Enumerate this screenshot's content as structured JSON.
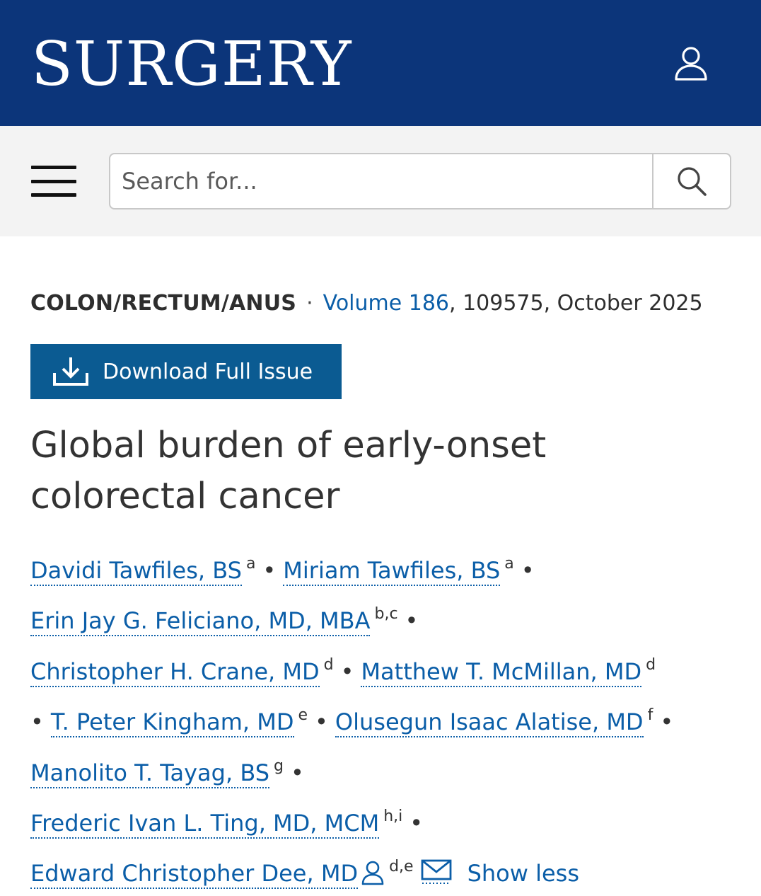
{
  "header": {
    "logo": "SURGERY"
  },
  "search": {
    "placeholder": "Search for..."
  },
  "article": {
    "section": "COLON/RECTUM/ANUS",
    "separator": "·",
    "volume_link": "Volume 186",
    "citation_rest": ", 109575, October 2025",
    "download_label": "Download Full Issue",
    "title_line1": "Global burden of early-onset",
    "title_line2": "colorectal cancer"
  },
  "authors": [
    {
      "name": "Davidi Tawfiles, BS",
      "aff": "a"
    },
    {
      "name": "Miriam Tawfiles, BS",
      "aff": "a"
    },
    {
      "name": "Erin Jay G. Feliciano, MD, MBA",
      "aff": "b,c"
    },
    {
      "name": "Christopher H. Crane, MD",
      "aff": "d"
    },
    {
      "name": "Matthew T. McMillan, MD",
      "aff": "d"
    },
    {
      "name": "T. Peter Kingham, MD",
      "aff": "e"
    },
    {
      "name": "Olusegun Isaac Alatise, MD",
      "aff": "f"
    },
    {
      "name": "Manolito T. Tayag, BS",
      "aff": "g"
    },
    {
      "name": "Frederic Ivan L. Ting, MD, MCM",
      "aff": "h,i"
    },
    {
      "name": "Edward Christopher Dee, MD",
      "aff": "d,e"
    }
  ],
  "dot": "•",
  "show_less": "Show less",
  "icons": {
    "account": "person-outline-icon",
    "menu": "hamburger-menu-icon",
    "search": "magnifier-icon",
    "download": "download-tray-icon",
    "corresponding": "person-outline-icon",
    "email": "envelope-icon"
  },
  "colors": {
    "header_bg": "#0c357a",
    "link": "#0b5ea8",
    "button_bg": "#0b5b92",
    "searchbar_bg": "#f3f3f3"
  }
}
